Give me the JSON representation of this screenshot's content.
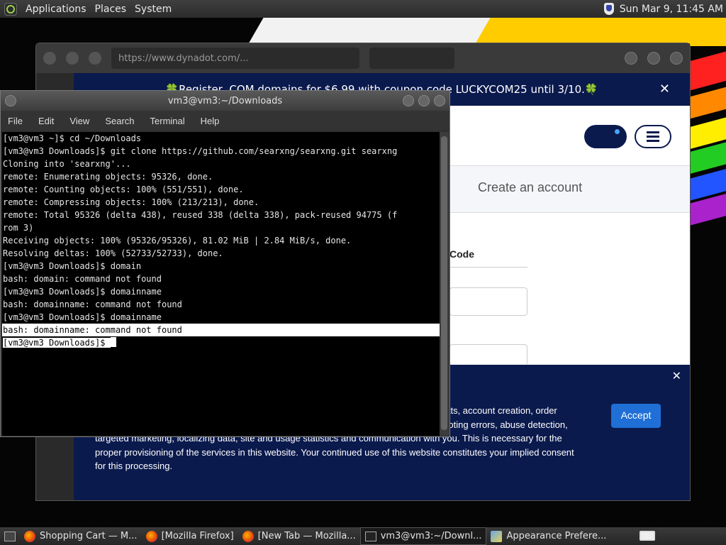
{
  "top_panel": {
    "applications": "Applications",
    "places": "Places",
    "system": "System",
    "clock": "Sun Mar  9, 11:45 AM"
  },
  "browser": {
    "url": "https://www.dynadot.com/...",
    "promo_text": "🍀Register .COM domains for $6.99 with coupon code LUCKYCOM25 until 3/10.🍀",
    "create_account": "Create an account",
    "code_label": "Code",
    "cookie_text": "...information about you: Google ...rankings, single sign-on (Open ID), forum views, chats, account creation, order placement and form submissions. The purposes for this processing include: troubleshooting errors, abuse detection, targeted marketing, localizing data, site and usage statistics and communication with you. This is necessary for the proper provisioning of the services in this website. Your continued use of this website constitutes your implied consent for this processing.",
    "accept": "Accept",
    "close_symbol": "✕"
  },
  "terminal": {
    "title": "vm3@vm3:~/Downloads",
    "menu": [
      "File",
      "Edit",
      "View",
      "Search",
      "Terminal",
      "Help"
    ],
    "lines": [
      "[vm3@vm3 ~]$ cd ~/Downloads",
      "[vm3@vm3 Downloads]$ git clone https://github.com/searxng/searxng.git searxng",
      "Cloning into 'searxng'...",
      "remote: Enumerating objects: 95326, done.",
      "remote: Counting objects: 100% (551/551), done.",
      "remote: Compressing objects: 100% (213/213), done.",
      "remote: Total 95326 (delta 438), reused 338 (delta 338), pack-reused 94775 (f",
      "rom 3)",
      "Receiving objects: 100% (95326/95326), 81.02 MiB | 2.84 MiB/s, done.",
      "Resolving deltas: 100% (52733/52733), done.",
      "[vm3@vm3 Downloads]$ domain",
      "bash: domain: command not found",
      "[vm3@vm3 Downloads]$ domainname",
      "bash: domainname: command not found",
      "[vm3@vm3 Downloads]$ domainname",
      "bash: domainname: command not found",
      "[vm3@vm3 Downloads]$ "
    ]
  },
  "taskbar": {
    "tasks": [
      "Shopping Cart — M...",
      "[Mozilla Firefox]",
      "[New Tab — Mozilla...",
      "vm3@vm3:~/Downl...",
      "Appearance Prefere..."
    ]
  }
}
